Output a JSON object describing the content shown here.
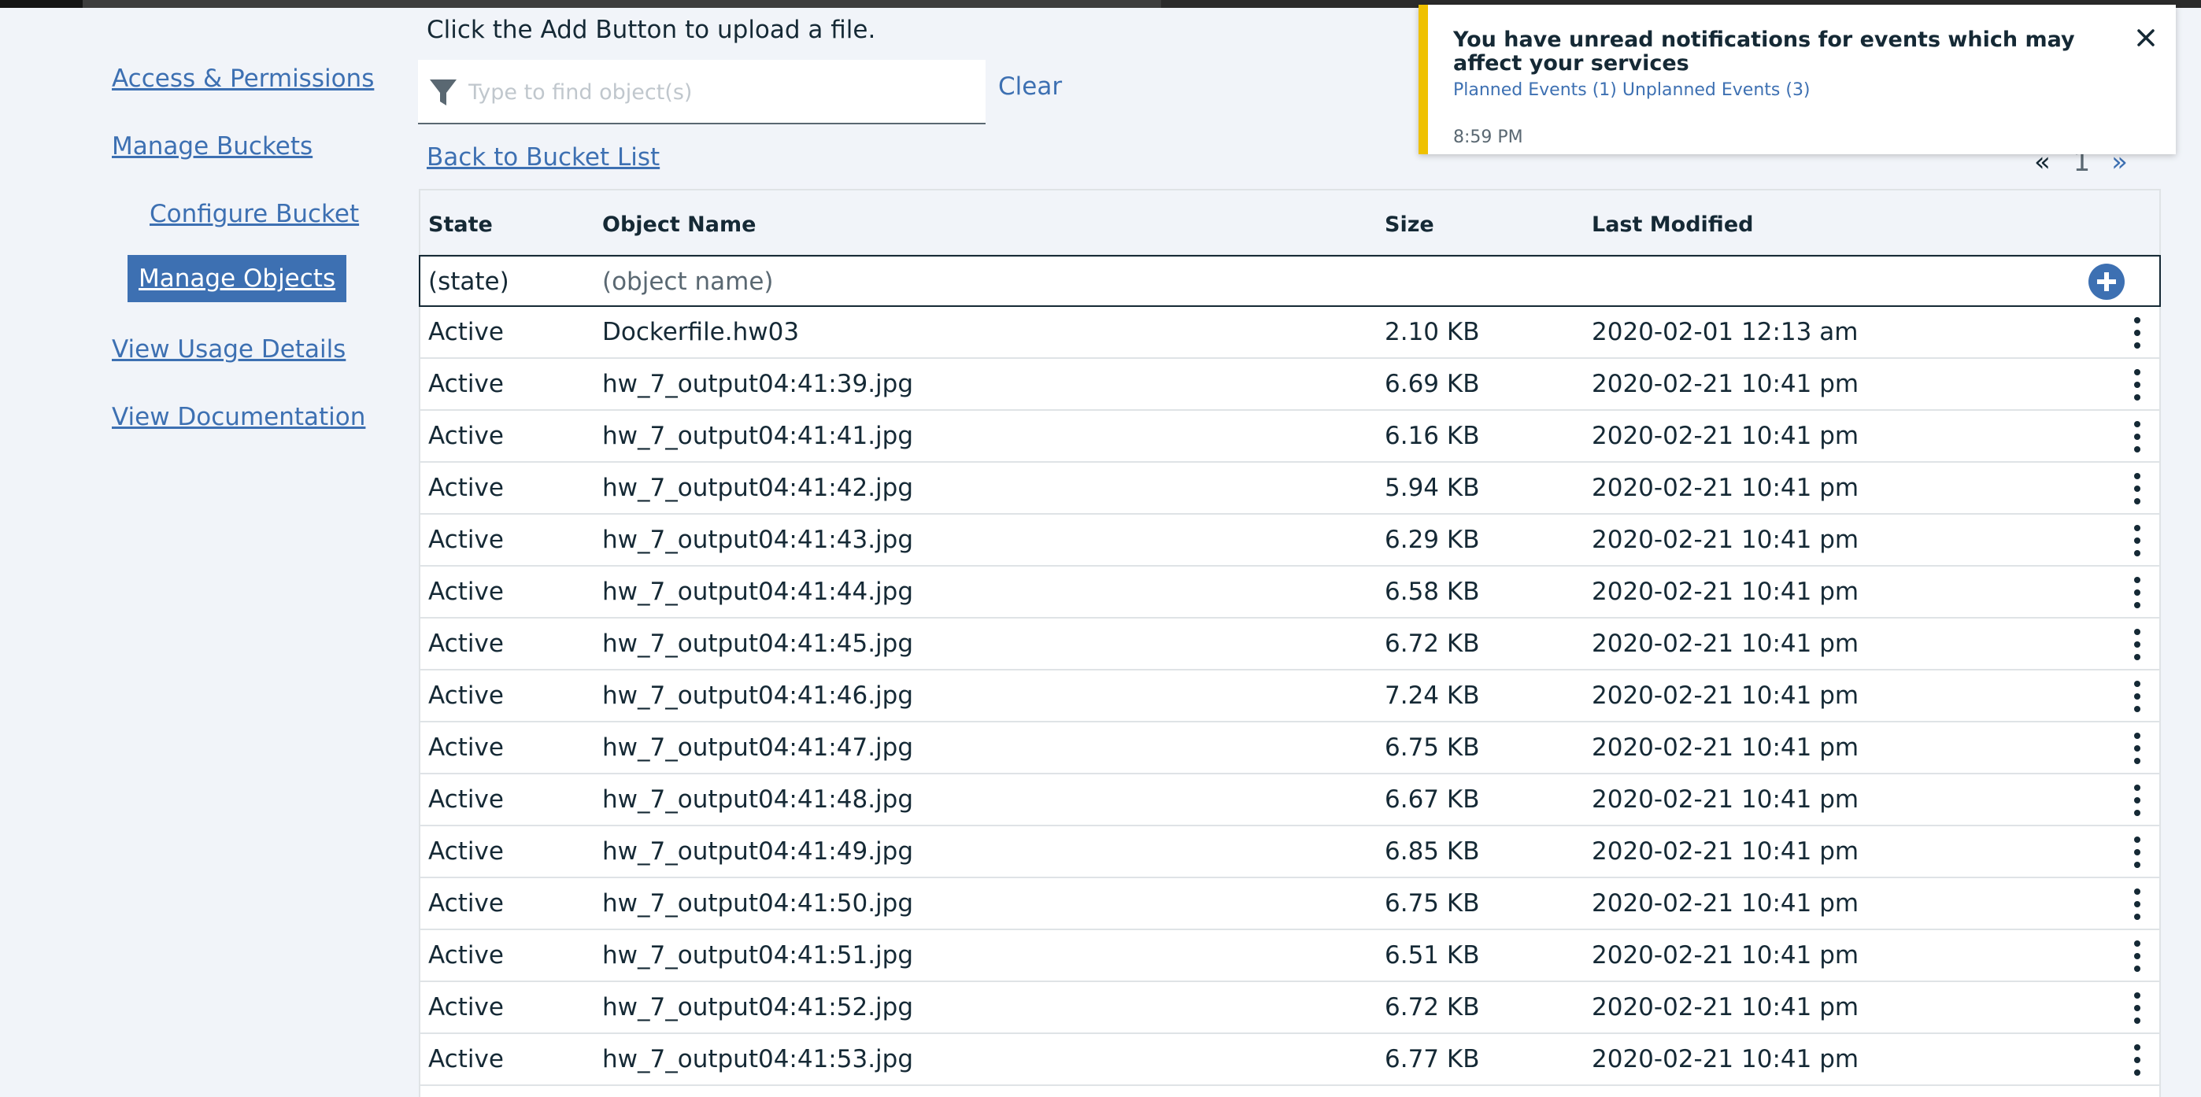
{
  "sidebar": {
    "items": [
      {
        "label": "Access & Permissions"
      },
      {
        "label": "Manage Buckets"
      },
      {
        "label": "Configure Bucket"
      },
      {
        "label": "Manage Objects"
      },
      {
        "label": "View Usage Details"
      },
      {
        "label": "View Documentation"
      }
    ]
  },
  "upload_hint": "Click the Add Button to upload a file.",
  "search": {
    "placeholder": "Type to find object(s)",
    "clear_label": "Clear"
  },
  "back_link": "Back to Bucket List",
  "pager": {
    "prev": "«",
    "page": "1",
    "next": "»"
  },
  "table": {
    "headers": {
      "state": "State",
      "name": "Object Name",
      "size": "Size",
      "modified": "Last Modified"
    },
    "add_row": {
      "state": "(state)",
      "name": "(object name)"
    },
    "rows": [
      {
        "state": "Active",
        "name": "Dockerfile.hw03",
        "size": "2.10 KB",
        "modified": "2020-02-01 12:13 am"
      },
      {
        "state": "Active",
        "name": "hw_7_output04:41:39.jpg",
        "size": "6.69 KB",
        "modified": "2020-02-21 10:41 pm"
      },
      {
        "state": "Active",
        "name": "hw_7_output04:41:41.jpg",
        "size": "6.16 KB",
        "modified": "2020-02-21 10:41 pm"
      },
      {
        "state": "Active",
        "name": "hw_7_output04:41:42.jpg",
        "size": "5.94 KB",
        "modified": "2020-02-21 10:41 pm"
      },
      {
        "state": "Active",
        "name": "hw_7_output04:41:43.jpg",
        "size": "6.29 KB",
        "modified": "2020-02-21 10:41 pm"
      },
      {
        "state": "Active",
        "name": "hw_7_output04:41:44.jpg",
        "size": "6.58 KB",
        "modified": "2020-02-21 10:41 pm"
      },
      {
        "state": "Active",
        "name": "hw_7_output04:41:45.jpg",
        "size": "6.72 KB",
        "modified": "2020-02-21 10:41 pm"
      },
      {
        "state": "Active",
        "name": "hw_7_output04:41:46.jpg",
        "size": "7.24 KB",
        "modified": "2020-02-21 10:41 pm"
      },
      {
        "state": "Active",
        "name": "hw_7_output04:41:47.jpg",
        "size": "6.75 KB",
        "modified": "2020-02-21 10:41 pm"
      },
      {
        "state": "Active",
        "name": "hw_7_output04:41:48.jpg",
        "size": "6.67 KB",
        "modified": "2020-02-21 10:41 pm"
      },
      {
        "state": "Active",
        "name": "hw_7_output04:41:49.jpg",
        "size": "6.85 KB",
        "modified": "2020-02-21 10:41 pm"
      },
      {
        "state": "Active",
        "name": "hw_7_output04:41:50.jpg",
        "size": "6.75 KB",
        "modified": "2020-02-21 10:41 pm"
      },
      {
        "state": "Active",
        "name": "hw_7_output04:41:51.jpg",
        "size": "6.51 KB",
        "modified": "2020-02-21 10:41 pm"
      },
      {
        "state": "Active",
        "name": "hw_7_output04:41:52.jpg",
        "size": "6.72 KB",
        "modified": "2020-02-21 10:41 pm"
      },
      {
        "state": "Active",
        "name": "hw_7_output04:41:53.jpg",
        "size": "6.77 KB",
        "modified": "2020-02-21 10:41 pm"
      }
    ]
  },
  "notification": {
    "title": "You have unread notifications for events which may affect your services",
    "planned": "Planned Events (1)",
    "unplanned": "Unplanned Events (3)",
    "time": "8:59 PM"
  },
  "icons": {
    "filter": "filter-icon",
    "add": "add-circle-icon",
    "kebab": "overflow-menu-icon",
    "close": "close-icon"
  },
  "colors": {
    "accent": "#3d70b2",
    "warning": "#efc100",
    "text": "#152935",
    "background": "#f1f4f9"
  }
}
